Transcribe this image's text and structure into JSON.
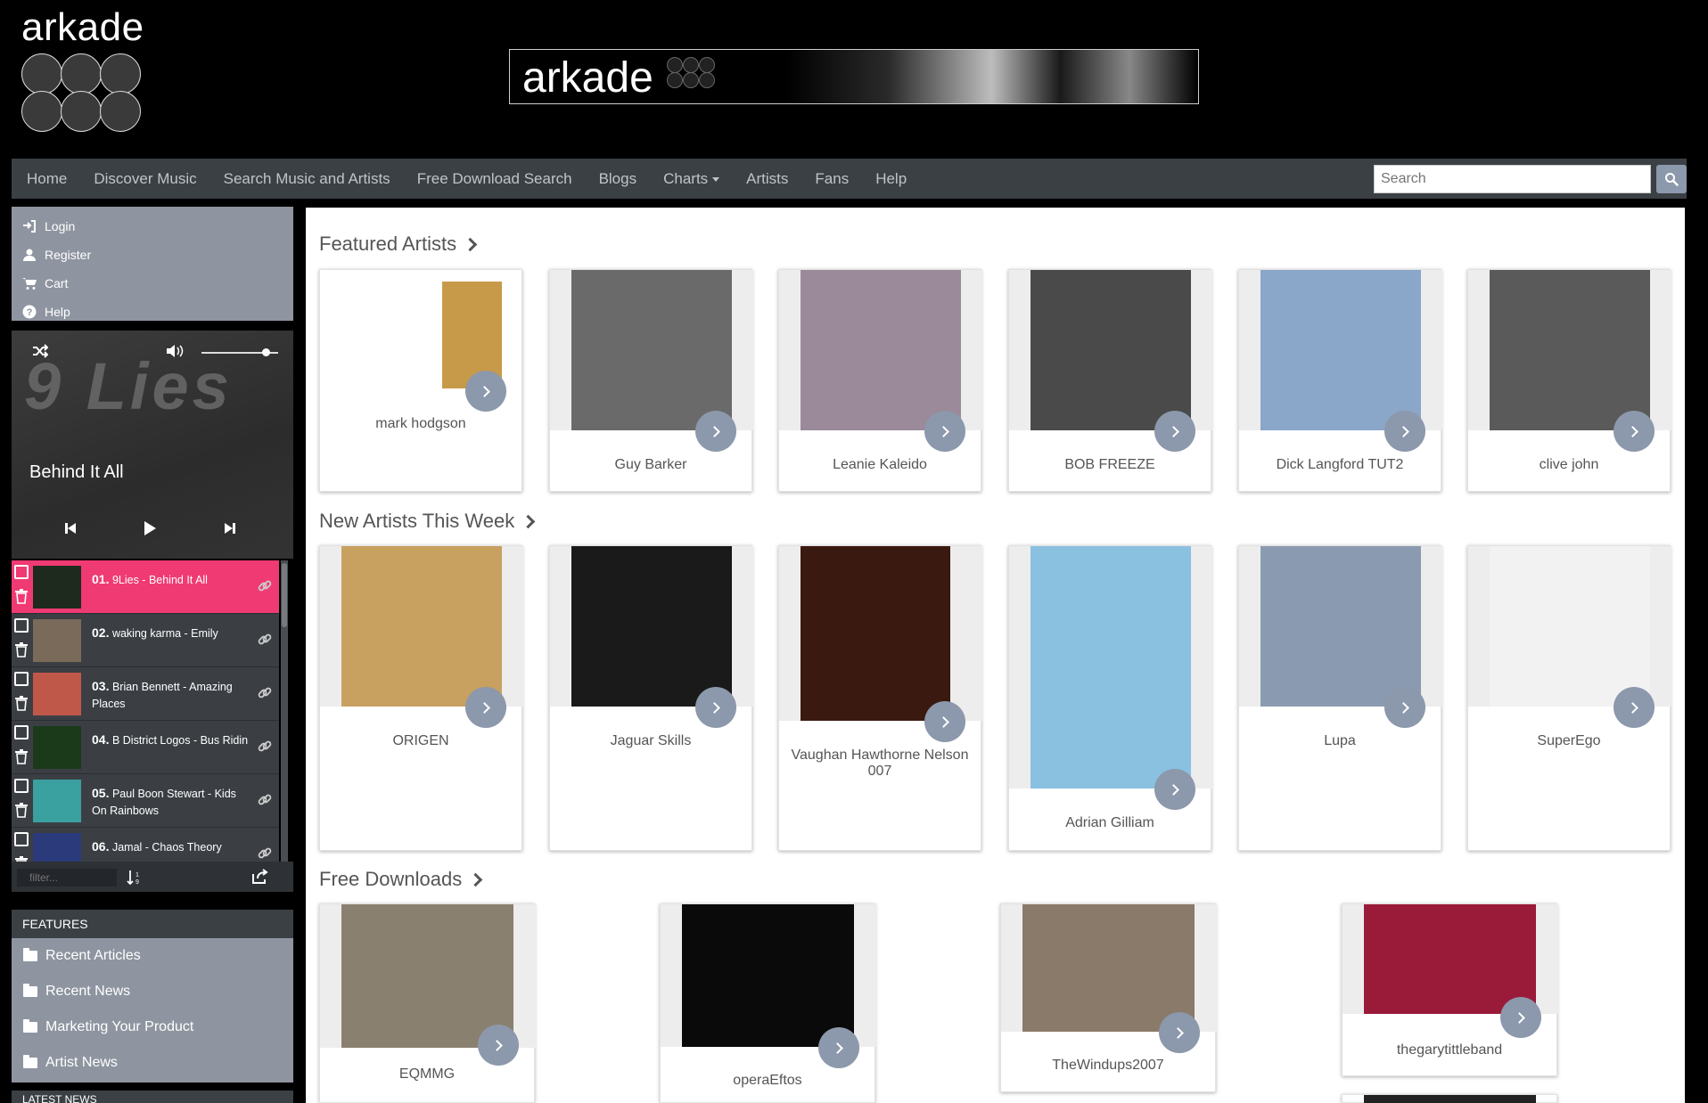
{
  "header": {
    "logo_text": "arkade",
    "banner_text": "arkade"
  },
  "nav": {
    "items": [
      "Home",
      "Discover Music",
      "Search Music and Artists",
      "Free Download Search",
      "Blogs",
      "Charts",
      "Artists",
      "Fans",
      "Help"
    ],
    "search_placeholder": "Search"
  },
  "account_menu": {
    "items": [
      {
        "label": "Login",
        "icon": "login-icon"
      },
      {
        "label": "Register",
        "icon": "user-icon"
      },
      {
        "label": "Cart",
        "icon": "cart-icon"
      },
      {
        "label": "Help",
        "icon": "question-icon"
      }
    ]
  },
  "player": {
    "now_playing_title": "Behind It All",
    "art_text": "9 Lies",
    "volume_level": 0.95
  },
  "playlist": {
    "items": [
      {
        "num": "01.",
        "text": "9Lies - Behind It All",
        "active": true,
        "thumb": "#1d2a1d"
      },
      {
        "num": "02.",
        "text": "waking karma - Emily",
        "active": false,
        "thumb": "#7a6a5a"
      },
      {
        "num": "03.",
        "text": "Brian Bennett - Amazing Places",
        "active": false,
        "thumb": "#c0584a"
      },
      {
        "num": "04.",
        "text": "B District Logos - Bus Ridin",
        "active": false,
        "thumb": "#1a3a1a"
      },
      {
        "num": "05.",
        "text": "Paul Boon Stewart - Kids On Rainbows",
        "active": false,
        "thumb": "#3aa0a0"
      },
      {
        "num": "06.",
        "text": "Jamal - Chaos Theory",
        "active": false,
        "thumb": "#2a3a7a"
      }
    ],
    "filter_placeholder": "filter..."
  },
  "features": {
    "heading": "FEATURES",
    "items": [
      "Recent Articles",
      "Recent News",
      "Marketing Your Product",
      "Artist News"
    ]
  },
  "latest_news": {
    "heading": "LATEST NEWS"
  },
  "sections": {
    "featured": {
      "title": "Featured Artists",
      "cards": [
        {
          "name": "mark hodgson",
          "color": "#c79a4a"
        },
        {
          "name": "Guy Barker",
          "color": "#6a6a6a"
        },
        {
          "name": "Leanie Kaleido",
          "color": "#9a8a9a"
        },
        {
          "name": "BOB FREEZE",
          "color": "#4a4a4a"
        },
        {
          "name": "Dick Langford TUT2",
          "color": "#8aa6c8"
        },
        {
          "name": "clive john",
          "color": "#5a5a5a"
        }
      ]
    },
    "new_artists": {
      "title": "New Artists This Week",
      "cards": [
        {
          "name": "ORIGEN",
          "color": "#c8a060"
        },
        {
          "name": "Jaguar Skills",
          "color": "#1a1a1a"
        },
        {
          "name": "Vaughan Hawthorne Nelson 007",
          "color": "#3a1a10"
        },
        {
          "name": "Adrian Gilliam",
          "color": "#8ac0e0"
        },
        {
          "name": "Lupa",
          "color": "#8a9ab0"
        },
        {
          "name": "SuperEgo",
          "color": "#f2f2f2"
        }
      ]
    },
    "free_downloads": {
      "title": "Free Downloads",
      "cards": [
        {
          "name": "EQMMG",
          "color": "#8a8070"
        },
        {
          "name": "operaEftos",
          "color": "#0a0a0a"
        },
        {
          "name": "TheWindups2007",
          "color": "#8a7a6a"
        },
        {
          "name": "thegarytittleband",
          "color": "#9a1a3a"
        }
      ]
    }
  }
}
